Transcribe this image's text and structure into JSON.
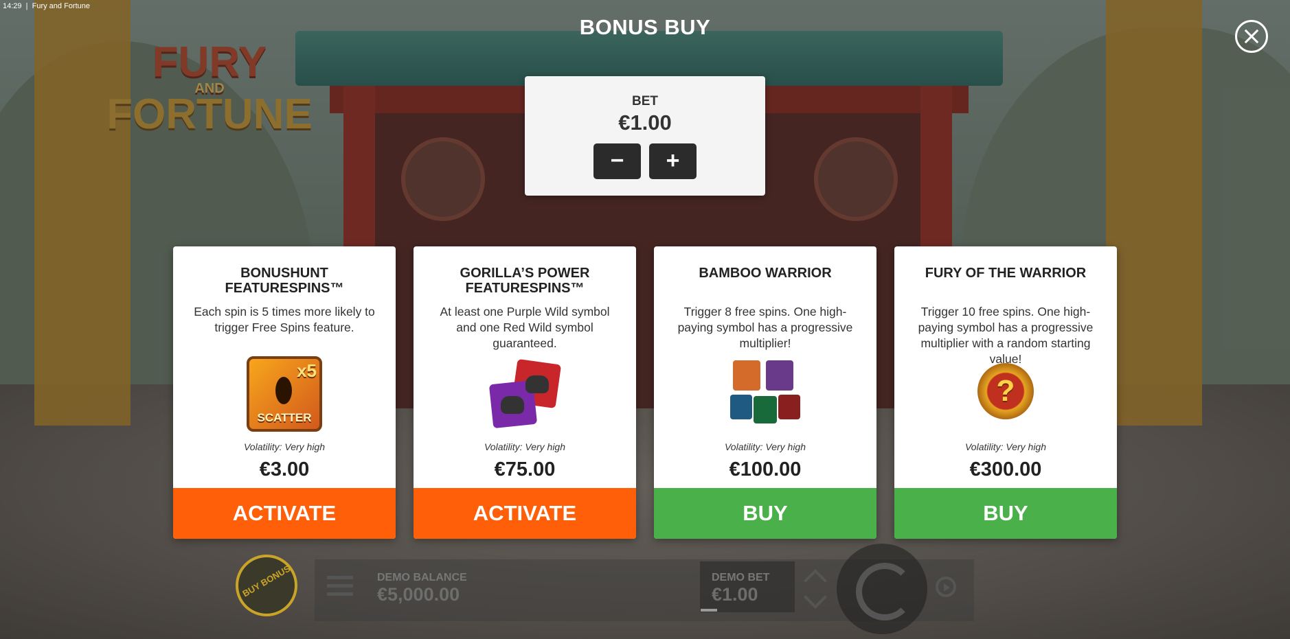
{
  "status_bar": {
    "time": "14:29",
    "window_title": "Fury and Fortune"
  },
  "logo": {
    "line1": "FURY",
    "line2": "AND",
    "line3": "FORTUNE"
  },
  "dialog": {
    "title": "BONUS BUY",
    "close_icon": "close-icon"
  },
  "bet": {
    "label": "BET",
    "value": "€1.00",
    "decrease_label": "−",
    "increase_label": "+"
  },
  "cards": [
    {
      "title": "BONUSHUNT FEATURESPINS™",
      "description": "Each spin is 5 times more likely to trigger Free Spins feature.",
      "icon": "scatter-x5-icon",
      "volatility": "Volatility: Very high",
      "price": "€3.00",
      "button_label": "ACTIVATE",
      "button_color": "#fe5f08"
    },
    {
      "title": "GORILLA’S POWER FEATURESPINS™",
      "description": "At least one Purple Wild symbol and one Red Wild symbol guaranteed.",
      "icon": "gorilla-wilds-icon",
      "volatility": "Volatility: Very high",
      "price": "€75.00",
      "button_label": "ACTIVATE",
      "button_color": "#fe5f08"
    },
    {
      "title": "BAMBOO WARRIOR",
      "description": "Trigger 8 free spins. One high-paying symbol has a progressive multiplier!",
      "icon": "warrior-symbols-icon",
      "volatility": "Volatility: Very high",
      "price": "€100.00",
      "button_label": "BUY",
      "button_color": "#49b04a"
    },
    {
      "title": "FURY OF THE WARRIOR",
      "description": "Trigger 10 free spins. One high-paying symbol has a progressive multiplier with a random starting value!",
      "icon": "mystery-orb-icon",
      "volatility": "Volatility: Very high",
      "price": "€300.00",
      "button_label": "BUY",
      "button_color": "#49b04a"
    }
  ],
  "scatter_icon": {
    "multiplier": "x5",
    "label": "SCATTER"
  },
  "fury_icon": {
    "glyph": "?"
  },
  "bottom_bar": {
    "buy_bonus_label": "BUY BONUS",
    "demo_balance_label": "DEMO BALANCE",
    "demo_balance_value": "€5,000.00",
    "demo_bet_label": "DEMO BET",
    "demo_bet_value": "€1.00"
  },
  "colors": {
    "orange": "#fe5f08",
    "green": "#49b04a",
    "panel": "#f4f4f4"
  }
}
